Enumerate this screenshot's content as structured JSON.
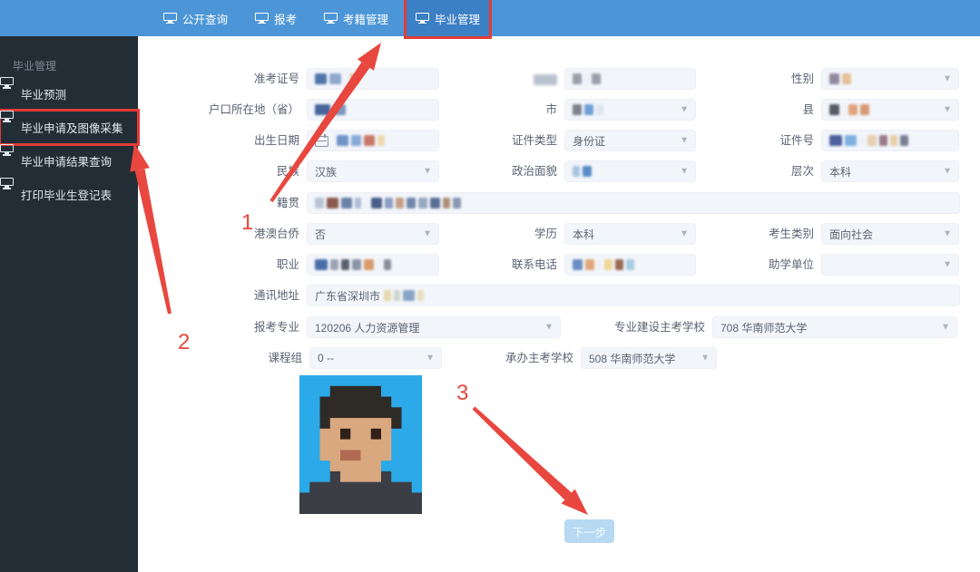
{
  "colors": {
    "header": "#4c96d8",
    "header_active": "#3b7fc4",
    "sidebar": "#222d36",
    "annotation_red": "#e8473f",
    "highlight_box_red": "#e23c36",
    "input_bg": "#f2f5fa",
    "button_bg": "#b7d9f2",
    "photo_bg": "#2ba9e8"
  },
  "nav": {
    "items": [
      {
        "label": "公开查询",
        "active": false,
        "boxed": false
      },
      {
        "label": "报考",
        "active": false,
        "boxed": false
      },
      {
        "label": "考籍管理",
        "active": false,
        "boxed": false
      },
      {
        "label": "毕业管理",
        "active": true,
        "boxed": true
      }
    ]
  },
  "sidebar": {
    "section_title": "毕业管理",
    "items": [
      {
        "label": "毕业预测",
        "boxed": false
      },
      {
        "label": "毕业申请及图像采集",
        "boxed": true
      },
      {
        "label": "毕业申请结果查询",
        "boxed": false
      },
      {
        "label": "打印毕业生登记表",
        "boxed": false
      }
    ]
  },
  "form": {
    "fields": [
      {
        "id": "zkzh",
        "label": "准考证号",
        "type": "input",
        "value": "",
        "masked": true,
        "mask": [
          [
            "#4f74a8",
            13
          ],
          [
            "#8fa8cc",
            13
          ],
          [
            "#eef1f5",
            4
          ],
          [
            "#e2b98e",
            9
          ]
        ]
      },
      {
        "id": "xm",
        "label": "姓名",
        "label_masked": true,
        "type": "input",
        "value": "",
        "masked": true,
        "mask": [
          [
            "#9aa0ab",
            10
          ],
          [
            "#eef1f5",
            5
          ],
          [
            "#9aa0ab",
            10
          ]
        ]
      },
      {
        "id": "xb",
        "label": "性别",
        "type": "select",
        "value": "",
        "masked": true,
        "mask": [
          [
            "#908aa2",
            11
          ],
          [
            "#e5c29c",
            10
          ]
        ]
      },
      {
        "id": "hkszd",
        "label": "户口所在地（省）",
        "type": "input",
        "value": "",
        "masked": true,
        "mask": [
          [
            "#47649b",
            17
          ],
          [
            "#7d95bf",
            14
          ]
        ]
      },
      {
        "id": "shi",
        "label": "市",
        "type": "select",
        "value": "",
        "masked": true,
        "mask": [
          [
            "#7d828c",
            10
          ],
          [
            "#6f9fd8",
            10
          ],
          [
            "#dfe5ee",
            8
          ]
        ]
      },
      {
        "id": "xian",
        "label": "县",
        "type": "select",
        "value": "",
        "masked": true,
        "mask": [
          [
            "#565b66",
            11
          ],
          [
            "#eef1f5",
            4
          ],
          [
            "#e0a47c",
            10
          ],
          [
            "#d89a74",
            10
          ]
        ]
      },
      {
        "id": "csrq",
        "label": "出生日期",
        "type": "date",
        "value": "",
        "masked": true,
        "mask": [
          [
            "#6f94c8",
            13
          ],
          [
            "#88a8d8",
            11
          ],
          [
            "#c87868",
            12
          ],
          [
            "#ecd8b0",
            8
          ]
        ]
      },
      {
        "id": "zjlx",
        "label": "证件类型",
        "type": "select",
        "value": "身份证",
        "masked": false
      },
      {
        "id": "zjh",
        "label": "证件号",
        "type": "input",
        "value": "",
        "masked": true,
        "mask": [
          [
            "#4a5f9c",
            14
          ],
          [
            "#7fb0e0",
            13
          ],
          [
            "#eef1f5",
            6
          ],
          [
            "#e6d0b0",
            10
          ],
          [
            "#9a7a88",
            9
          ],
          [
            "#e8d0a8",
            8
          ],
          [
            "#7a7f94",
            9
          ]
        ]
      },
      {
        "id": "mz",
        "label": "民族",
        "type": "select",
        "value": "汉族",
        "masked": false
      },
      {
        "id": "zzmm",
        "label": "政治面貌",
        "type": "select",
        "value": "",
        "masked": true,
        "mask": [
          [
            "#a8c4e0",
            8
          ],
          [
            "#5b8cc8",
            10
          ]
        ]
      },
      {
        "id": "cc",
        "label": "层次",
        "type": "select",
        "value": "本科",
        "masked": false
      },
      {
        "id": "jg",
        "label": "籍贯",
        "type": "input",
        "value": "",
        "masked": true,
        "mask": [
          [
            "#b8c4d4",
            10
          ],
          [
            "#8a5a50",
            13
          ],
          [
            "#6a82a8",
            12
          ],
          [
            "#aebed4",
            7
          ],
          [
            "#eef1f5",
            5
          ],
          [
            "#4a5f88",
            12
          ],
          [
            "#8aa0c0",
            9
          ],
          [
            "#c4a088",
            9
          ],
          [
            "#7088ac",
            10
          ],
          [
            "#98a8c0",
            10
          ],
          [
            "#5a6f94",
            11
          ],
          [
            "#b09078",
            8
          ],
          [
            "#8898b4",
            9
          ]
        ]
      },
      {
        "id": "gatq",
        "label": "港澳台侨",
        "type": "select",
        "value": "否",
        "masked": false
      },
      {
        "id": "xl",
        "label": "学历",
        "type": "select",
        "value": "本科",
        "masked": false
      },
      {
        "id": "kslb",
        "label": "考生类别",
        "type": "select",
        "value": "面向社会",
        "masked": false
      },
      {
        "id": "zy",
        "label": "职业",
        "type": "input",
        "value": "",
        "masked": true,
        "mask": [
          [
            "#4a6fa8",
            14
          ],
          [
            "#9aa4b0",
            9
          ],
          [
            "#5a5f6a",
            9
          ],
          [
            "#8a94a4",
            10
          ],
          [
            "#d89a6c",
            11
          ],
          [
            "#eef1f5",
            5
          ],
          [
            "#8a8f9a",
            8
          ]
        ]
      },
      {
        "id": "lxdh",
        "label": "联系电话",
        "type": "input",
        "value": "",
        "masked": true,
        "mask": [
          [
            "#6a8cc0",
            11
          ],
          [
            "#e0a878",
            10
          ],
          [
            "#eef1f5",
            5
          ],
          [
            "#ecd898",
            9
          ],
          [
            "#9a6a58",
            9
          ],
          [
            "#a8cce0",
            9
          ]
        ]
      },
      {
        "id": "zxdw",
        "label": "助学单位",
        "type": "select",
        "value": "",
        "masked": false
      },
      {
        "id": "txdz",
        "label": "通讯地址",
        "type": "input",
        "value": "广东省深圳市",
        "masked": true,
        "mask": [
          [
            "#e8d8b0",
            8
          ],
          [
            "#cdd8cd",
            7
          ],
          [
            "#8aa4c8",
            13
          ],
          [
            "#e8dcc0",
            7
          ]
        ]
      },
      {
        "id": "bkzy",
        "label": "报考专业",
        "type": "select",
        "value": "120206 人力资源管理",
        "masked": false
      },
      {
        "id": "zyjs",
        "label": "专业建设主考学校",
        "type": "select",
        "value": "708 华南师范大学",
        "masked": false
      },
      {
        "id": "kcz",
        "label": "课程组",
        "type": "select",
        "value": "0 --",
        "masked": false
      },
      {
        "id": "cbzk",
        "label": "承办主考学校",
        "type": "select",
        "value": "508 华南师范大学",
        "masked": false
      }
    ]
  },
  "photo": {
    "alt": "考生证件照"
  },
  "next_button": {
    "label": "下一步"
  },
  "annotations": {
    "numbers": [
      {
        "text": "1"
      },
      {
        "text": "2"
      },
      {
        "text": "3"
      }
    ]
  }
}
